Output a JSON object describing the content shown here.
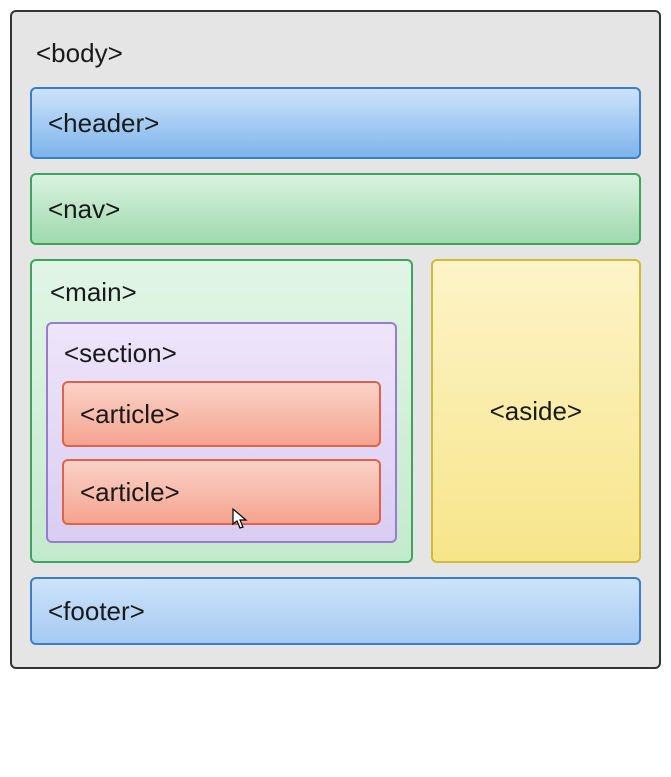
{
  "labels": {
    "body": "<body>",
    "header": "<header>",
    "nav": "<nav>",
    "main": "<main>",
    "section": "<section>",
    "article1": "<article>",
    "article2": "<article>",
    "aside": "<aside>",
    "footer": "<footer>"
  },
  "colors": {
    "body_bg": "#e5e5e5",
    "header_border": "#3a7fc9",
    "nav_border": "#3ca65a",
    "main_border": "#3ca65a",
    "section_border": "#9a7bd4",
    "article_border": "#e0624a",
    "aside_border": "#d4b83a",
    "footer_border": "#3a7fc9"
  }
}
